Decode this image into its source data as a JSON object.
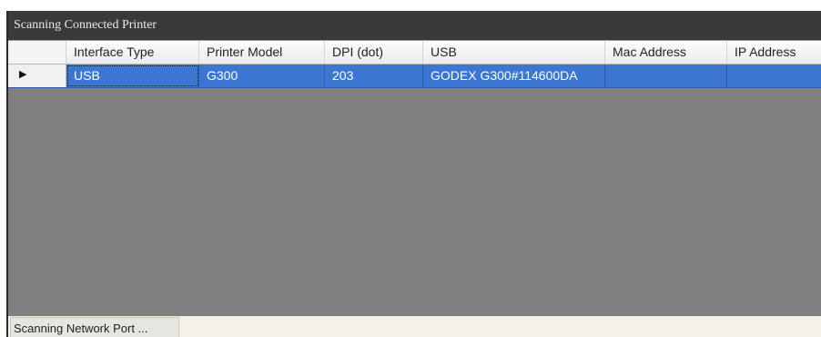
{
  "window": {
    "title": "Scanning Connected Printer"
  },
  "grid": {
    "columns": [
      "Interface Type",
      "Printer Model",
      "DPI (dot)",
      "USB",
      "Mac Address",
      "IP Address"
    ],
    "rows": [
      {
        "indicator": "▶",
        "cells": [
          "USB",
          "G300",
          "203",
          "GODEX G300#114600DA",
          "",
          ""
        ]
      }
    ]
  },
  "status": {
    "label": "Scanning Network Port ..."
  },
  "colors": {
    "selection": "#3a76d2",
    "grid_background": "#808080",
    "titlebar": "#3a3a3a"
  }
}
